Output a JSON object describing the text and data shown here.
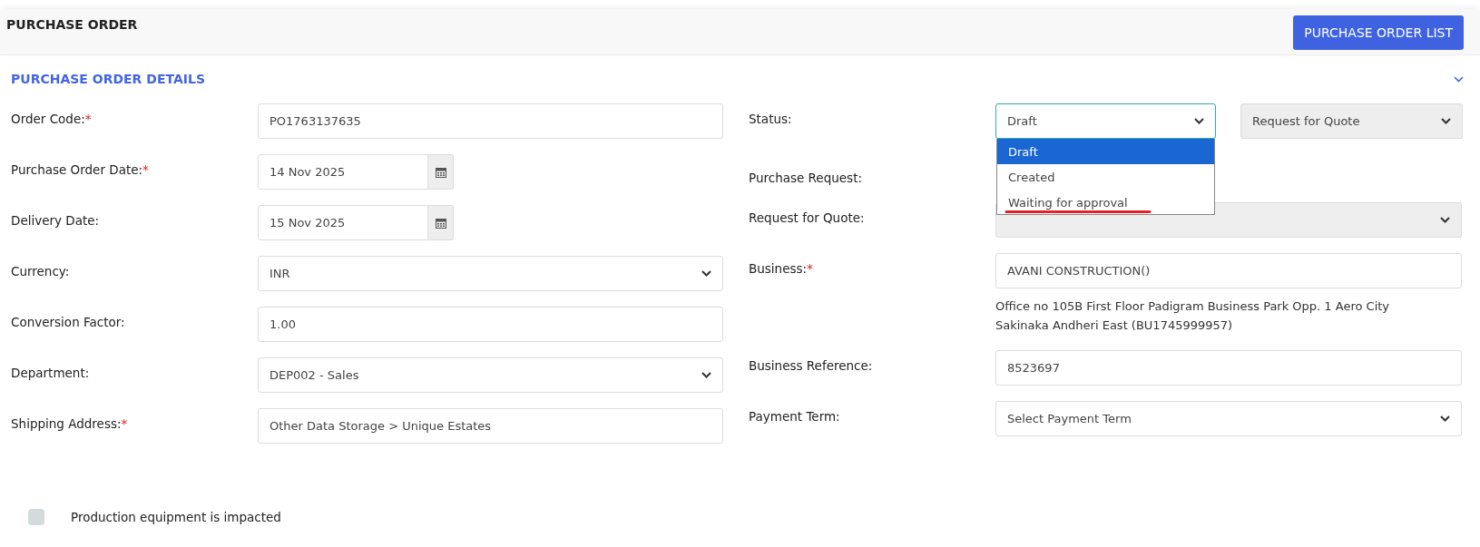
{
  "page_title": "PURCHASE ORDER",
  "list_button": "PURCHASE ORDER LIST",
  "section": {
    "title": "PURCHASE ORDER DETAILS",
    "expanded": true
  },
  "left_fields": [
    {
      "label": "Order Code:",
      "required_mark": "*",
      "kind": "text",
      "value": "PO1763137635"
    },
    {
      "label": "Purchase Order Date:",
      "required_mark": "*",
      "kind": "date",
      "value": "14 Nov 2025"
    },
    {
      "label": "Delivery Date:",
      "kind": "date",
      "value": "15 Nov 2025"
    },
    {
      "label": "Currency:",
      "kind": "select",
      "value": "INR"
    },
    {
      "label": "Conversion Factor:",
      "kind": "text",
      "value": "1.00"
    },
    {
      "label": "Department:",
      "kind": "select",
      "value": "DEP002 - Sales"
    },
    {
      "label": "Shipping Address:",
      "required_mark": "*",
      "kind": "text",
      "value": "Other Data Storage > Unique Estates"
    }
  ],
  "right_fields": [
    {
      "label": "Status:",
      "kind": "status",
      "value": "Draft",
      "side_select": "Request for Quote",
      "options": [
        {
          "label": "Draft",
          "selected": true
        },
        {
          "label": "Created",
          "selected": false
        },
        {
          "label": "Waiting for approval",
          "selected": false
        }
      ]
    },
    {
      "label": "Purchase Request:",
      "kind": "none"
    },
    {
      "label": "Request for Quote:",
      "kind": "disabled-select"
    },
    {
      "label": "Business:",
      "required_mark": "*",
      "kind": "text",
      "value": "AVANI CONSTRUCTION()",
      "note": "Office no 105B First Floor Padigram Business Park Opp. 1 Aero City Sakinaka Andheri East (BU1745999957)"
    },
    {
      "label": "Business Reference:",
      "kind": "text",
      "value": "8523697"
    },
    {
      "label": "Payment Term:",
      "kind": "select",
      "value": "Select Payment Term"
    }
  ],
  "checkbox": {
    "label": "Production equipment is impacted",
    "checked": false
  }
}
